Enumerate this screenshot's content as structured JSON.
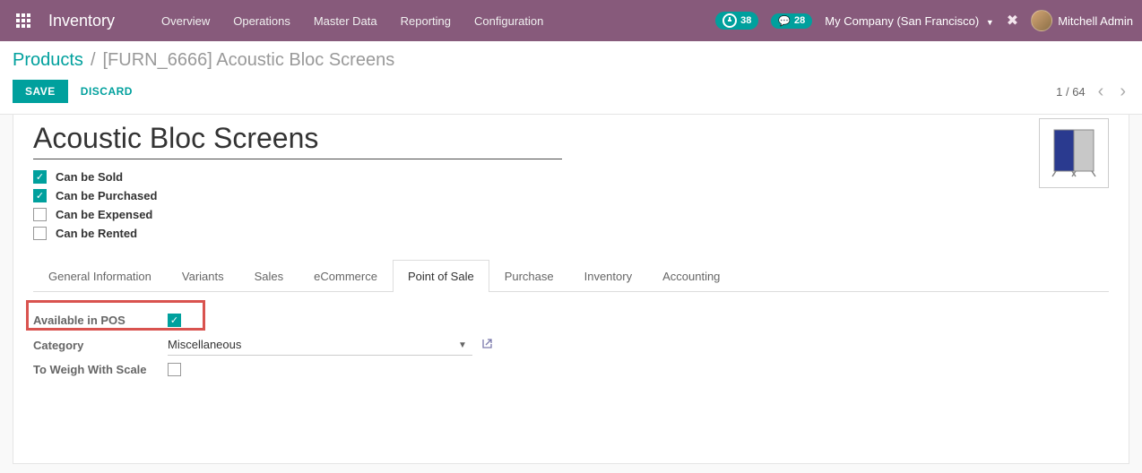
{
  "topbar": {
    "app_title": "Inventory",
    "menu": [
      "Overview",
      "Operations",
      "Master Data",
      "Reporting",
      "Configuration"
    ],
    "badge_clock": "38",
    "badge_chat": "28",
    "company": "My Company (San Francisco)",
    "user": "Mitchell Admin"
  },
  "breadcrumb": {
    "link": "Products",
    "current": "[FURN_6666] Acoustic Bloc Screens"
  },
  "actions": {
    "save": "SAVE",
    "discard": "DISCARD",
    "pager": "1 / 64"
  },
  "product": {
    "name": "Acoustic Bloc Screens",
    "attrs": [
      {
        "label": "Can be Sold",
        "checked": true
      },
      {
        "label": "Can be Purchased",
        "checked": true
      },
      {
        "label": "Can be Expensed",
        "checked": false
      },
      {
        "label": "Can be Rented",
        "checked": false
      }
    ]
  },
  "tabs": [
    "General Information",
    "Variants",
    "Sales",
    "eCommerce",
    "Point of Sale",
    "Purchase",
    "Inventory",
    "Accounting"
  ],
  "pos_tab": {
    "available_label": "Available in POS",
    "available_checked": true,
    "category_label": "Category",
    "category_value": "Miscellaneous",
    "weigh_label": "To Weigh With Scale",
    "weigh_checked": false
  }
}
